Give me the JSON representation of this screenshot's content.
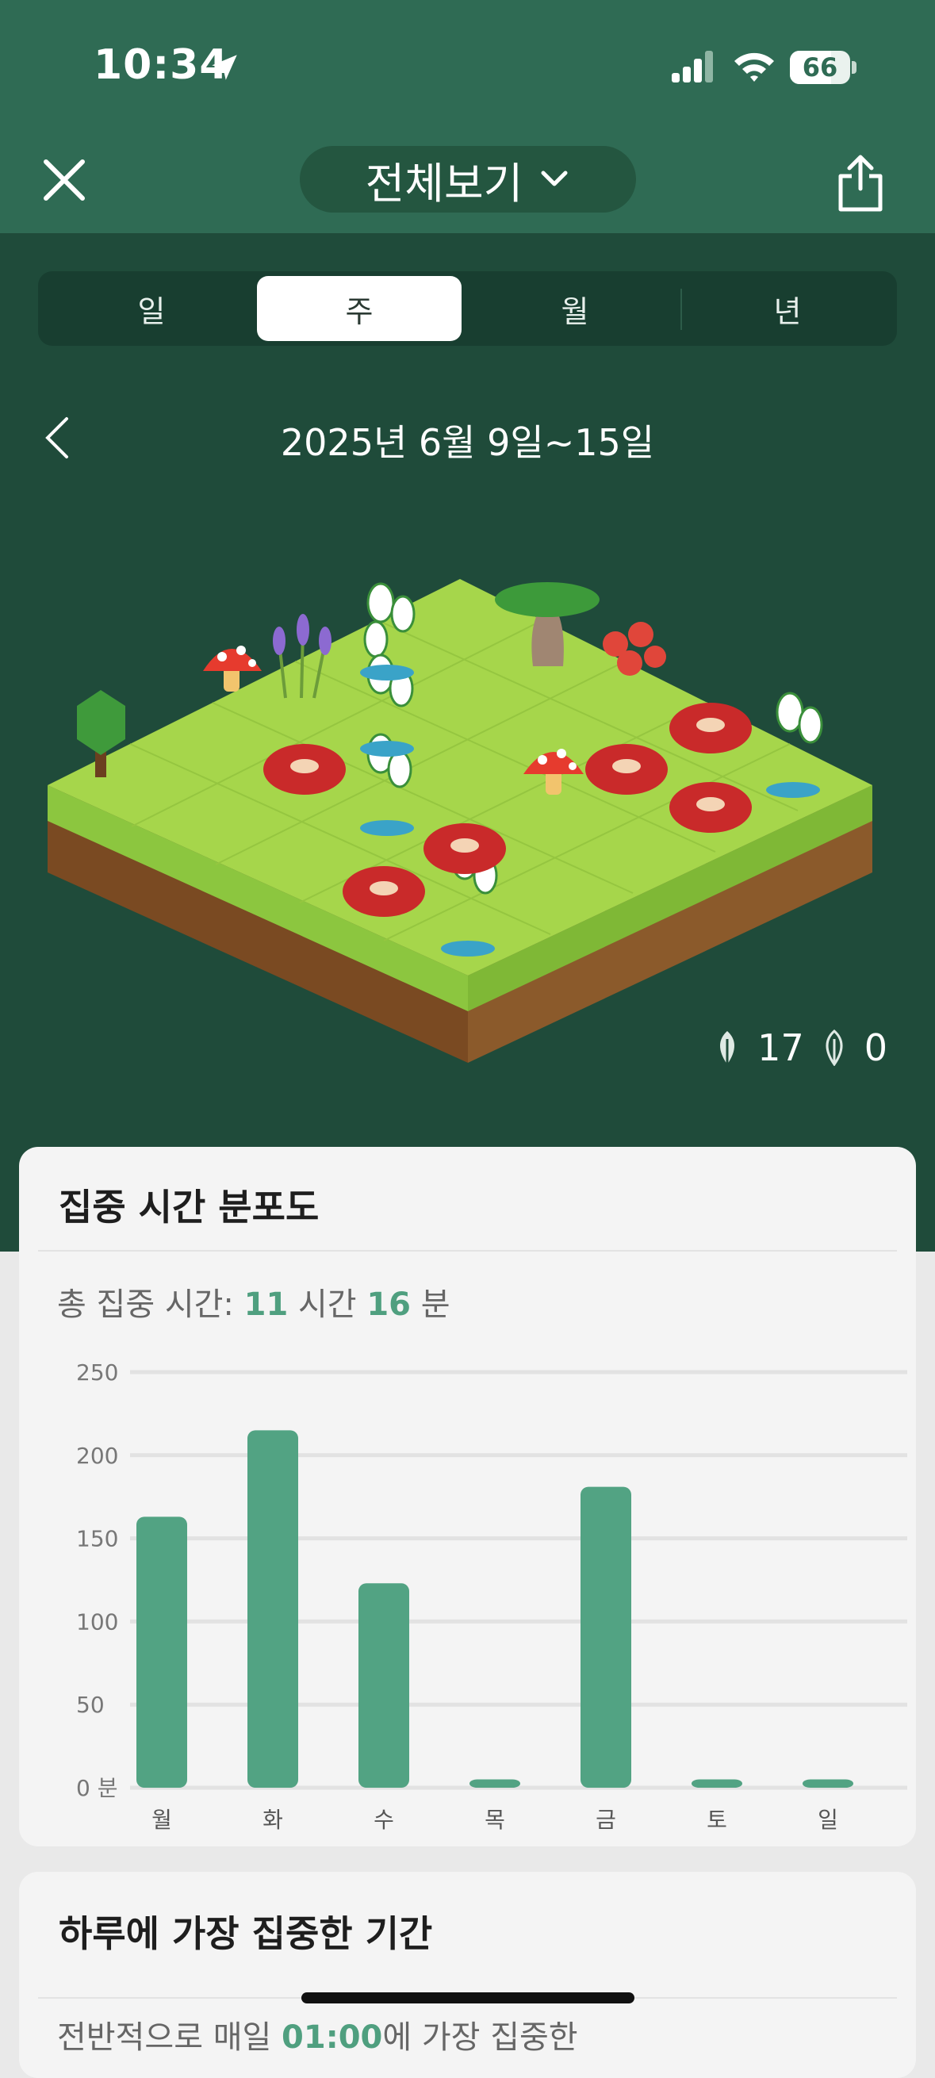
{
  "status_bar": {
    "time": "10:34",
    "battery": "66"
  },
  "header": {
    "title": "전체보기"
  },
  "segments": [
    {
      "label": "일",
      "active": false
    },
    {
      "label": "주",
      "active": true
    },
    {
      "label": "월",
      "active": false
    },
    {
      "label": "년",
      "active": false
    }
  ],
  "date_range": "2025년 6월 9일~15일",
  "forest_counts": {
    "healthy": "17",
    "withered": "0"
  },
  "focus_card": {
    "title": "집중 시간 분포도",
    "total_prefix": "총 집중 시간: ",
    "hours": "11",
    "hours_unit": " 시간 ",
    "minutes": "16",
    "minutes_unit": " 분"
  },
  "chart_data": {
    "type": "bar",
    "categories": [
      "월",
      "화",
      "수",
      "목",
      "금",
      "토",
      "일"
    ],
    "values": [
      163,
      215,
      123,
      5,
      181,
      5,
      5
    ],
    "ylim": [
      0,
      250
    ],
    "yticks": [
      "0 분",
      "50",
      "100",
      "150",
      "200",
      "250"
    ],
    "grid": true,
    "bar_color": "#52a383"
  },
  "peak_card": {
    "title": "하루에 가장 집중한 기간",
    "text_prefix": "전반적으로 매일 ",
    "time": "01:00",
    "text_suffix": "에 가장 집중한"
  },
  "colors": {
    "header_green": "#2f6b54",
    "dark_green": "#1f4b3a",
    "accent": "#4f9f7f"
  }
}
